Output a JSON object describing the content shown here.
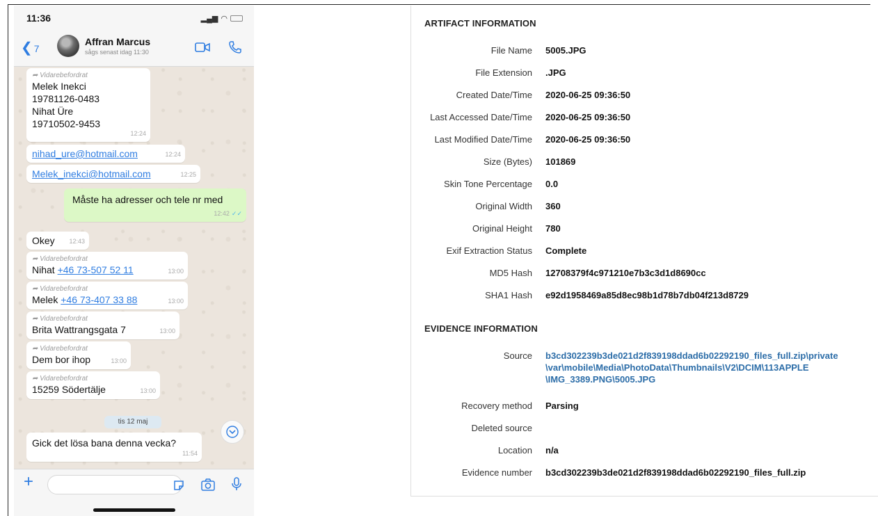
{
  "phone": {
    "status_time": "11:36",
    "header": {
      "back_count": "7",
      "contact_name": "Affran Marcus",
      "contact_status": "sågs senast idag 11:30"
    },
    "messages": [
      {
        "forwarded": "Vidarebefordrat",
        "lines": [
          "Melek Inekci",
          "19781126-0483",
          "Nihat Üre",
          "19710502-9453"
        ],
        "time": "12:24"
      },
      {
        "link": "nihad_ure@hotmail.com",
        "time": "12:24"
      },
      {
        "link": "Melek_inekci@hotmail.com",
        "time": "12:25"
      },
      {
        "text": "Måste ha adresser och tele nr med",
        "time": "12:42"
      },
      {
        "text": "Okey",
        "time": "12:43"
      },
      {
        "forwarded": "Vidarebefordrat",
        "prefix": "Nihat",
        "link": "+46 73-507 52 11",
        "time": "13:00"
      },
      {
        "forwarded": "Vidarebefordrat",
        "prefix": "Melek",
        "link": "+46 73-407 33 88",
        "time": "13:00"
      },
      {
        "forwarded": "Vidarebefordrat",
        "text": "Brita Wattrangsgata 7",
        "time": "13:00"
      },
      {
        "forwarded": "Vidarebefordrat",
        "text": "Dem bor ihop",
        "time": "13:00"
      },
      {
        "forwarded": "Vidarebefordrat",
        "text": "15259 Södertälje",
        "time": "13:00"
      },
      {
        "text": "Gick det lösa bana denna vecka?",
        "time": "11:54"
      }
    ],
    "date_chip": "tis 12 maj",
    "colors": {
      "accent": "#2f7de1",
      "outgoing": "#dcf8c6",
      "background": "#ece5dd"
    }
  },
  "artifact": {
    "title": "ARTIFACT INFORMATION",
    "rows": [
      {
        "label": "File Name",
        "value": "5005.JPG"
      },
      {
        "label": "File Extension",
        "value": ".JPG"
      },
      {
        "label": "Created Date/Time",
        "value": "2020-06-25 09:36:50"
      },
      {
        "label": "Last Accessed Date/Time",
        "value": "2020-06-25 09:36:50"
      },
      {
        "label": "Last Modified Date/Time",
        "value": "2020-06-25 09:36:50"
      },
      {
        "label": "Size (Bytes)",
        "value": "101869"
      },
      {
        "label": "Skin Tone Percentage",
        "value": "0.0"
      },
      {
        "label": "Original Width",
        "value": "360"
      },
      {
        "label": "Original Height",
        "value": "780"
      },
      {
        "label": "Exif Extraction Status",
        "value": "Complete"
      },
      {
        "label": "MD5 Hash",
        "value": "12708379f4c971210e7b3c3d1d8690cc"
      },
      {
        "label": "SHA1 Hash",
        "value": "e92d1958469a85d8ec98b1d78b7db04f213d8729"
      }
    ]
  },
  "evidence": {
    "title": "EVIDENCE INFORMATION",
    "source_label": "Source",
    "source_lines": [
      "b3cd302239b3de021d2f839198ddad6b02292190_files_full.zip\\private",
      "\\var\\mobile\\Media\\PhotoData\\Thumbnails\\V2\\DCIM\\113APPLE",
      "\\IMG_3389.PNG\\5005.JPG"
    ],
    "rows": [
      {
        "label": "Recovery method",
        "value": "Parsing"
      },
      {
        "label": "Deleted source",
        "value": ""
      },
      {
        "label": "Location",
        "value": "n/a"
      },
      {
        "label": "Evidence number",
        "value": "b3cd302239b3de021d2f839198ddad6b02292190_files_full.zip"
      }
    ],
    "link_color": "#2c6da8"
  }
}
